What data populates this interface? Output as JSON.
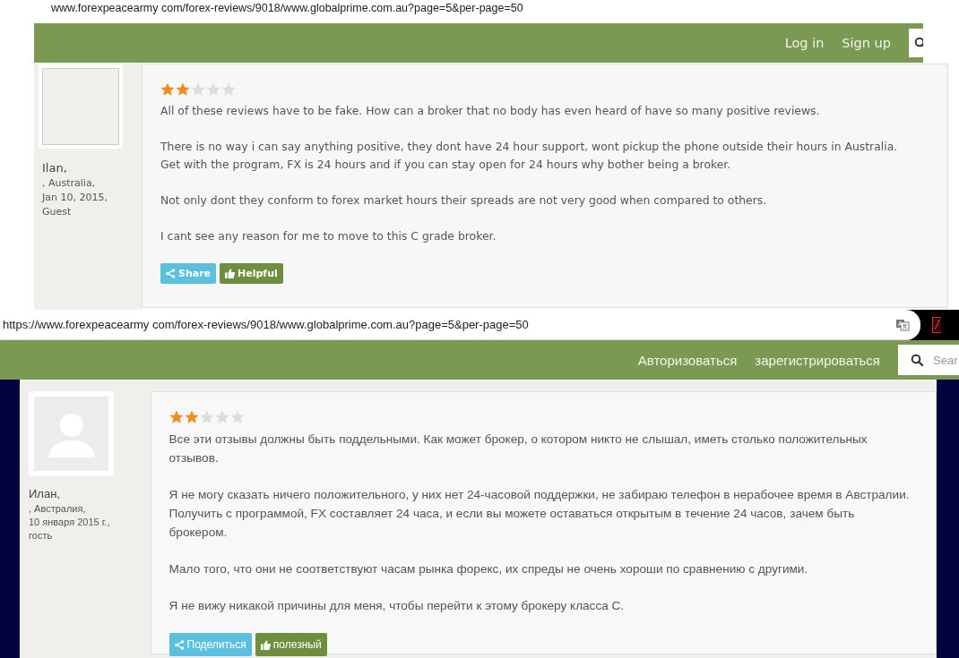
{
  "panels": [
    {
      "kind": "plain_url",
      "url": "www.forexpeacearmy com/forex-reviews/9018/www.globalprime.com.au?page=5&per-page=50",
      "nav": [
        {
          "label": "Log in"
        },
        {
          "label": "Sign up"
        }
      ],
      "search": {
        "kind": "icon_only"
      },
      "review": {
        "avatar": {
          "kind": "empty"
        },
        "name": "Ilan,",
        "location": ", Australia,",
        "date": "Jan 10, 2015,",
        "role": "Guest",
        "stars": 2,
        "paragraphs": [
          "All of these reviews have to be fake. How can a broker that no body has even heard of have so many positive reviews.",
          "There is no way i can say anything positive, they dont have 24 hour support, wont pickup the phone outside their hours in Australia. Get with the program, FX is 24 hours and if you can stay open for 24 hours why bother being a broker.",
          "Not only dont they conform to forex market hours their spreads are not very good when compared to others.",
          "I cant see any reason for me to move to this C grade broker."
        ],
        "buttons": [
          {
            "kind": "share",
            "label": "Share"
          },
          {
            "kind": "helpful",
            "label": "Helpful"
          }
        ]
      }
    },
    {
      "kind": "address_bar",
      "url": "https://www.forexpeacearmy com/forex-reviews/9018/www.globalprime.com.au?page=5&per-page=50",
      "nav": [
        {
          "label": "Авторизоваться"
        },
        {
          "label": "зарегистрироваться"
        }
      ],
      "search": {
        "kind": "with_placeholder",
        "placeholder": "Sear"
      },
      "review": {
        "avatar": {
          "kind": "silhouette"
        },
        "name": "Илан,",
        "location": ", Австралия,",
        "date": "10 января 2015 г.,",
        "role": "гость",
        "stars": 2,
        "paragraphs": [
          "Все эти отзывы должны быть поддельными. Как может брокер, о котором никто не слышал, иметь столько положительных отзывов.",
          "Я не могу сказать ничего положительного, у них нет 24-часовой поддержки, не забираю телефон в нерабочее время в Австралии. Получить с программой, FX составляет 24 часа, и если вы можете оставаться открытым в течение 24 часов, зачем быть брокером.",
          "Мало того, что они не соответствуют часам рынка форекс, их спреды не очень хороши по сравнению с другими.",
          "Я не вижу никакой причины для меня, чтобы перейти к этому брокеру класса С."
        ],
        "buttons": [
          {
            "kind": "share",
            "label": "Поделиться"
          },
          {
            "kind": "helpful",
            "label": "полезный"
          }
        ]
      }
    }
  ]
}
